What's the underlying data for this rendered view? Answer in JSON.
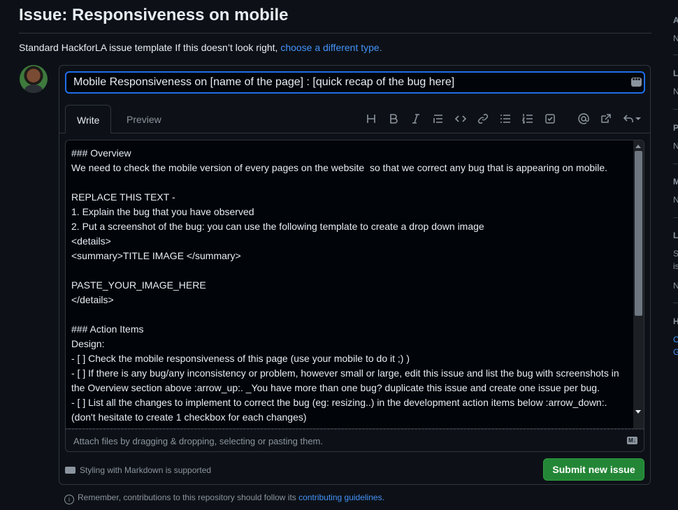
{
  "issue_title": "Issue: Responsiveness on mobile",
  "template": {
    "text": "Standard HackforLA issue template If this doesn’t look right,",
    "link": "choose a different type."
  },
  "form": {
    "title_value": "Mobile Responsiveness on [name of the page] : [quick recap of the bug here]",
    "dots_label": "•••",
    "tabs": [
      {
        "label": "Write"
      },
      {
        "label": "Preview"
      }
    ],
    "toolbar_icons": [
      "heading-icon",
      "bold-icon",
      "italic-icon",
      "quote-icon",
      "code-icon",
      "link-icon",
      "unordered-list-icon",
      "ordered-list-icon",
      "task-list-icon",
      "mention-icon",
      "cross-reference-icon",
      "reply-icon"
    ],
    "body": "### Overview\nWe need to check the mobile version of every pages on the website  so that we correct any bug that is appearing on mobile.\n\nREPLACE THIS TEXT -\n1. Explain the bug that you have observed\n2. Put a screenshot of the bug: you can use the following template to create a drop down image\n<details>\n<summary>TITLE IMAGE </summary>\n\nPASTE_YOUR_IMAGE_HERE\n</details>\n\n### Action Items\nDesign:\n- [ ] Check the mobile responsiveness of this page (use your mobile to do it ;) )\n- [ ] If there is any bug/any inconsistency or problem, however small or large, edit this issue and list the bug with screenshots in the Overview section above :arrow_up:. _You have more than one bug? duplicate this issue and create one issue per bug.\n- [ ] List all the changes to implement to correct the bug (eg: resizing..) in the development action items below :arrow_down:. (don't hesitate to create 1 checkbox for each changes)\n- [ ] Put the issue(s) in the review column to check the feasibility with the dev",
    "attach_text": "Attach files by dragging & dropping, selecting or pasting them.",
    "markdown_note": "Styling with Markdown is supported",
    "submit_label": "Submit new issue"
  },
  "contrib": {
    "text": "Remember, contributions to this repository should follow its",
    "link": "contributing guidelines."
  },
  "sidebar": {
    "items": [
      {
        "head": "A",
        "value": "N"
      },
      {
        "head": "L",
        "value": "N"
      },
      {
        "head": "P",
        "value": "N"
      },
      {
        "head": "M",
        "value": "N"
      },
      {
        "head": "L",
        "line1": "S",
        "line2": "is",
        "value": "N"
      },
      {
        "head": "H",
        "link1": "C",
        "link2": "G"
      }
    ]
  },
  "colors": {
    "accent": "#1f6feb",
    "link": "#4493f8",
    "submit": "#238636",
    "background": "#0d1117"
  }
}
